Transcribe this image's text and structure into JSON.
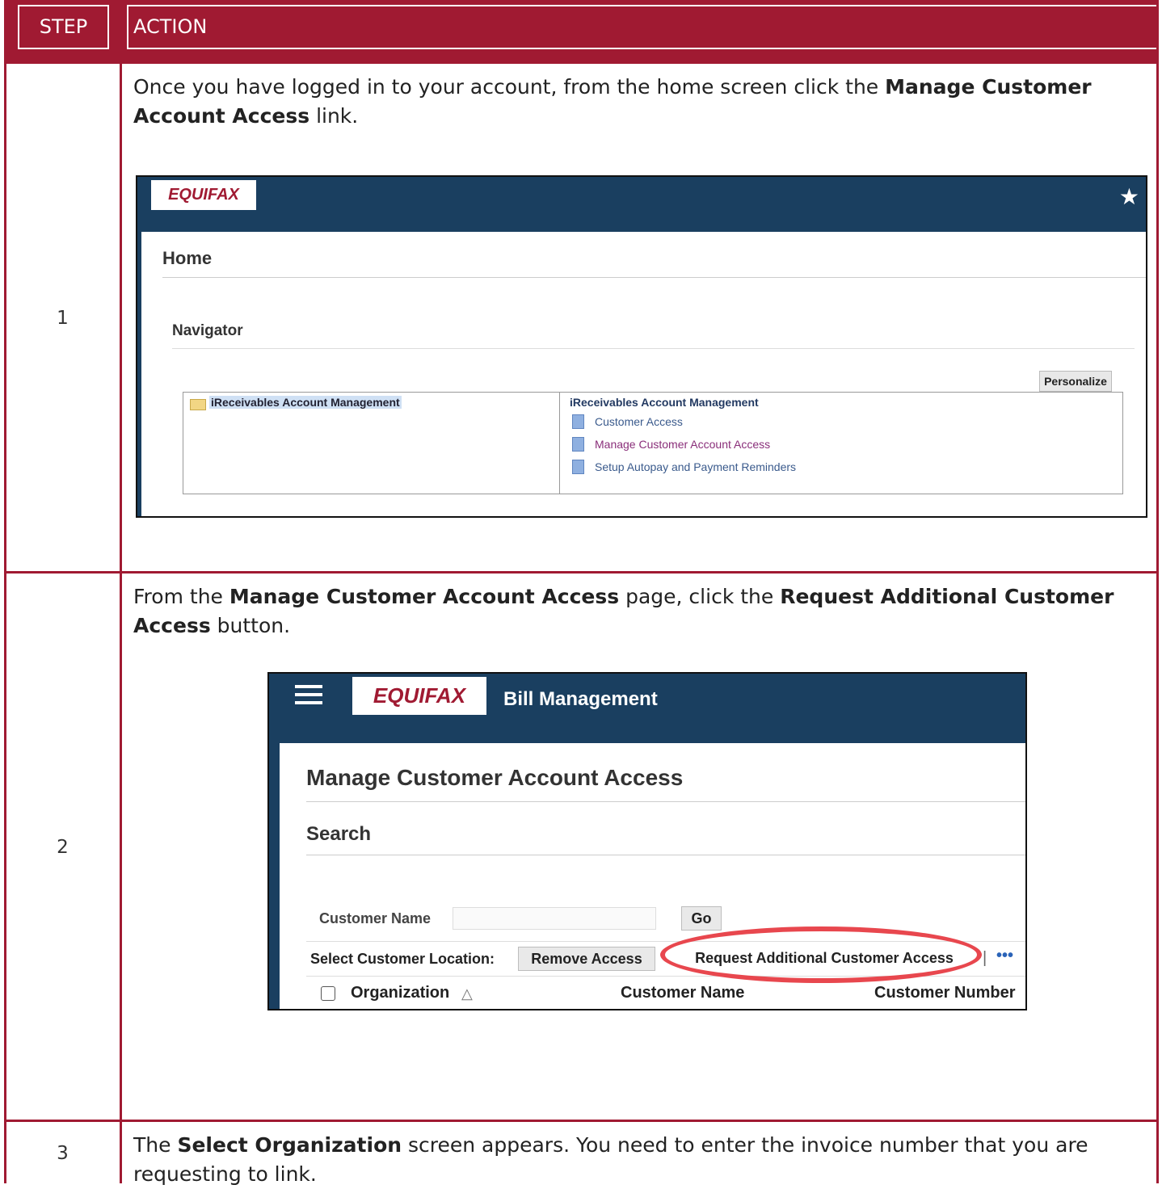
{
  "header": {
    "step_label": "STEP",
    "action_label": "ACTION"
  },
  "colors": {
    "brand_red": "#a01a32",
    "navy": "#1a3f60",
    "highlight_oval": "#e8474e"
  },
  "rows": [
    {
      "step": "1",
      "text": [
        {
          "t": "Once you have logged in to your account, from the home screen click the ",
          "b": false
        },
        {
          "t": "Manage Customer Account Access",
          "b": true
        },
        {
          "t": " link.",
          "b": false
        }
      ]
    },
    {
      "step": "2",
      "text": [
        {
          "t": "From the ",
          "b": false
        },
        {
          "t": "Manage Customer Account Access",
          "b": true
        },
        {
          "t": " page, click the ",
          "b": false
        },
        {
          "t": "Request Additional Customer Access",
          "b": true
        },
        {
          "t": " button.",
          "b": false
        }
      ]
    },
    {
      "step": "3",
      "text": [
        {
          "t": "The ",
          "b": false
        },
        {
          "t": "Select Organization",
          "b": true
        },
        {
          "t": " screen appears. You need to enter the invoice number that you are requesting to link.",
          "b": false
        }
      ]
    }
  ],
  "screenshot1": {
    "logo": "EQUIFAX",
    "favorite_icon": "star-icon",
    "home_title": "Home",
    "navigator_title": "Navigator",
    "personalize_label": "Personalize",
    "tree_item": "iReceivables Account Management",
    "right_title": "iReceivables Account Management",
    "links": [
      "Customer Access",
      "Manage Customer Account Access",
      "Setup Autopay and Payment Reminders"
    ],
    "link_colors": [
      "#3a5a8c",
      "#8a2f7a",
      "#3a5a8c"
    ]
  },
  "screenshot2": {
    "logo": "EQUIFAX",
    "menu_icon": "hamburger-icon",
    "app_name": "Bill Management",
    "page_title": "Manage Customer Account Access",
    "search_title": "Search",
    "customer_name_label": "Customer Name",
    "customer_name_value": "",
    "go_label": "Go",
    "select_location_label": "Select Customer Location:",
    "remove_access_label": "Remove Access",
    "request_access_label": "Request Additional Customer Access",
    "separator": "|",
    "more_label": "•••",
    "columns": [
      "Organization",
      "Customer Name",
      "Customer Number"
    ]
  }
}
